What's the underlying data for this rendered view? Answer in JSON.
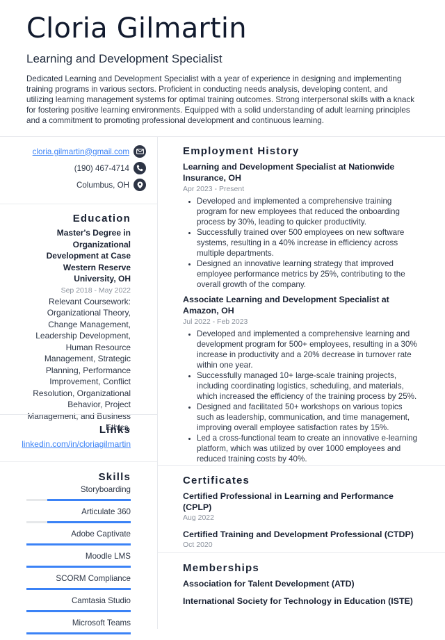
{
  "header": {
    "name": "Cloria Gilmartin",
    "title": "Learning and Development Specialist",
    "summary": "Dedicated Learning and Development Specialist with a year of experience in designing and implementing training programs in various sectors. Proficient in conducting needs analysis, developing content, and utilizing learning management systems for optimal training outcomes. Strong interpersonal skills with a knack for fostering positive learning environments. Equipped with a solid understanding of adult learning principles and a commitment to promoting professional development and continuous learning."
  },
  "contact": {
    "email": "cloria.gilmartin@gmail.com",
    "phone": "(190) 467-4714",
    "location": "Columbus, OH",
    "icons": [
      "envelope-icon",
      "phone-icon",
      "map-pin-icon"
    ]
  },
  "education": {
    "heading": "Education",
    "degree": "Master's Degree in Organizational Development at Case Western Reserve University, OH",
    "dates": "Sep 2018 - May 2022",
    "coursework": "Relevant Coursework: Organizational Theory, Change Management, Leadership Development, Human Resource Management, Strategic Planning, Performance Improvement, Conflict Resolution, Organizational Behavior, Project Management, and Business Ethics."
  },
  "links": {
    "heading": "Links",
    "items": [
      "linkedin.com/in/cloriagilmartin"
    ]
  },
  "skills": {
    "heading": "Skills",
    "accent": "#3b82f6",
    "items": [
      {
        "name": "Storyboarding",
        "level": 0.8
      },
      {
        "name": "Articulate 360",
        "level": 0.8
      },
      {
        "name": "Adobe Captivate",
        "level": 1.0
      },
      {
        "name": "Moodle LMS",
        "level": 1.0
      },
      {
        "name": "SCORM Compliance",
        "level": 1.0
      },
      {
        "name": "Camtasia Studio",
        "level": 1.0
      },
      {
        "name": "Microsoft Teams",
        "level": 1.0
      }
    ]
  },
  "employment": {
    "heading": "Employment History",
    "jobs": [
      {
        "title": "Learning and Development Specialist at Nationwide Insurance, OH",
        "dates": "Apr 2023 - Present",
        "bullets": [
          "Developed and implemented a comprehensive training program for new employees that reduced the onboarding process by 30%, leading to quicker productivity.",
          "Successfully trained over 500 employees on new software systems, resulting in a 40% increase in efficiency across multiple departments.",
          "Designed an innovative learning strategy that improved employee performance metrics by 25%, contributing to the overall growth of the company."
        ]
      },
      {
        "title": "Associate Learning and Development Specialist at Amazon, OH",
        "dates": "Jul 2022 - Feb 2023",
        "bullets": [
          "Developed and implemented a comprehensive learning and development program for 500+ employees, resulting in a 30% increase in productivity and a 20% decrease in turnover rate within one year.",
          "Successfully managed 10+ large-scale training projects, including coordinating logistics, scheduling, and materials, which increased the efficiency of the training process by 25%.",
          "Designed and facilitated 50+ workshops on various topics such as leadership, communication, and time management, improving overall employee satisfaction rates by 15%.",
          "Led a cross-functional team to create an innovative e-learning platform, which was utilized by over 1000 employees and reduced training costs by 40%."
        ]
      }
    ]
  },
  "certificates": {
    "heading": "Certificates",
    "items": [
      {
        "title": "Certified Professional in Learning and Performance (CPLP)",
        "date": "Aug 2022"
      },
      {
        "title": "Certified Training and Development Professional (CTDP)",
        "date": "Oct 2020"
      }
    ]
  },
  "memberships": {
    "heading": "Memberships",
    "items": [
      "Association for Talent Development (ATD)",
      "International Society for Technology in Education (ISTE)"
    ]
  }
}
